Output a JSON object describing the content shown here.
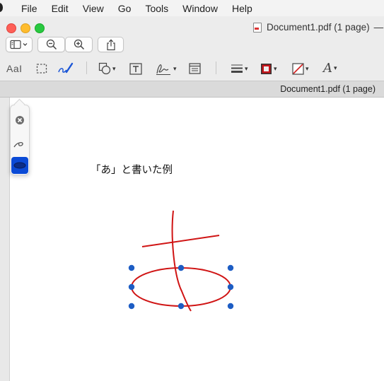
{
  "menubar": {
    "items": [
      "File",
      "Edit",
      "View",
      "Go",
      "Tools",
      "Window",
      "Help"
    ]
  },
  "window": {
    "title": "Document1.pdf (1 page)",
    "title_suffix": "—",
    "filename_label": "Document1.pdf (1 page)"
  },
  "toolbar": {
    "text_style_label": "AaI",
    "row1": [
      "sidebar-icon",
      "zoom-out-icon",
      "zoom-in-icon",
      "share-icon"
    ],
    "row2": [
      "text-style-icon",
      "rect-select-icon",
      "sketch-icon",
      "shapes-icon",
      "text-box-icon",
      "sign-icon",
      "note-icon",
      "line-style-icon",
      "border-color-icon",
      "fill-color-icon",
      "font-icon"
    ],
    "border_color": "#c6141a",
    "sketch_color": "#1a55d6"
  },
  "sketch_popover": {
    "items": [
      "clear-icon",
      "pen-stroke-icon",
      "shape-stroke-icon"
    ],
    "selected": "shape-stroke-icon"
  },
  "document": {
    "text": "「あ」と書いた例",
    "stroke_color": "#d01515",
    "handle_color": "#1d5dc4"
  }
}
